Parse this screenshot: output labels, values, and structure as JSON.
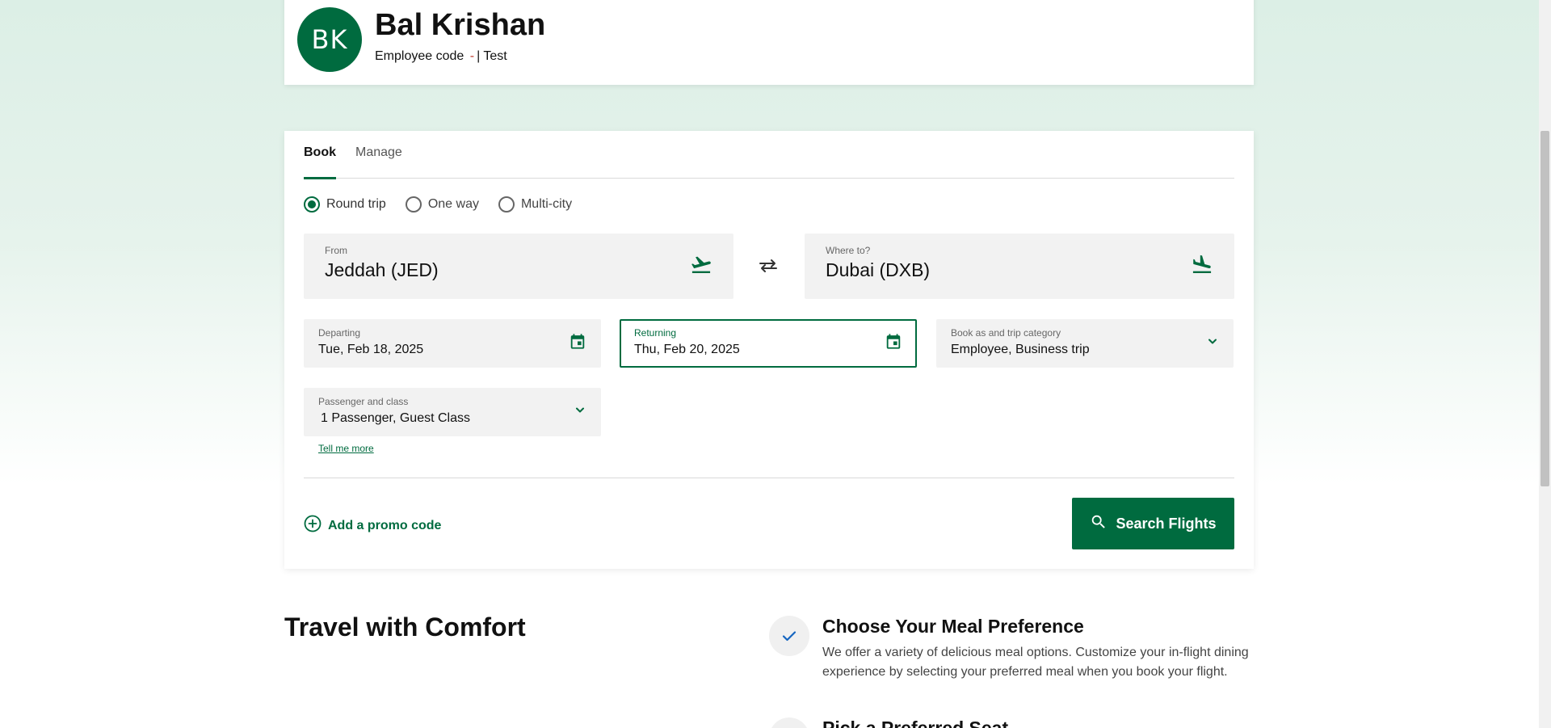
{
  "profile": {
    "initials": "BK",
    "name": "Bal Krishan",
    "employee_code_label": "Employee code",
    "employee_code_value": "-",
    "separator": "|",
    "tag": "Test"
  },
  "tabs": [
    {
      "label": "Book",
      "active": true
    },
    {
      "label": "Manage",
      "active": false
    }
  ],
  "trip_types": [
    {
      "label": "Round trip",
      "selected": true
    },
    {
      "label": "One way",
      "selected": false
    },
    {
      "label": "Multi-city",
      "selected": false
    }
  ],
  "from": {
    "label": "From",
    "value": "Jeddah (JED)",
    "icon": "plane-takeoff-icon"
  },
  "to": {
    "label": "Where to?",
    "value": "Dubai (DXB)",
    "icon": "plane-landing-icon"
  },
  "departing": {
    "label": "Departing",
    "value": "Tue, Feb 18, 2025",
    "icon": "calendar-icon"
  },
  "returning": {
    "label": "Returning",
    "value": "Thu, Feb 20, 2025",
    "icon": "calendar-icon"
  },
  "category": {
    "label": "Book as and trip category",
    "value": "Employee, Business trip"
  },
  "passenger": {
    "label": "Passenger and class",
    "value": "1 Passenger, Guest Class",
    "link": "Tell me more"
  },
  "promo_label": "Add a promo code",
  "search_label": "Search Flights",
  "comfort": {
    "title": "Travel with Comfort",
    "features": [
      {
        "title": "Choose Your Meal Preference",
        "description": "We offer a variety of delicious meal options. Customize your in-flight dining experience by selecting your preferred meal when you book your flight."
      },
      {
        "title": "Pick a Preferred Seat",
        "description": ""
      }
    ]
  },
  "colors": {
    "accent": "#006b3f",
    "field_bg": "#f2f2f2"
  }
}
